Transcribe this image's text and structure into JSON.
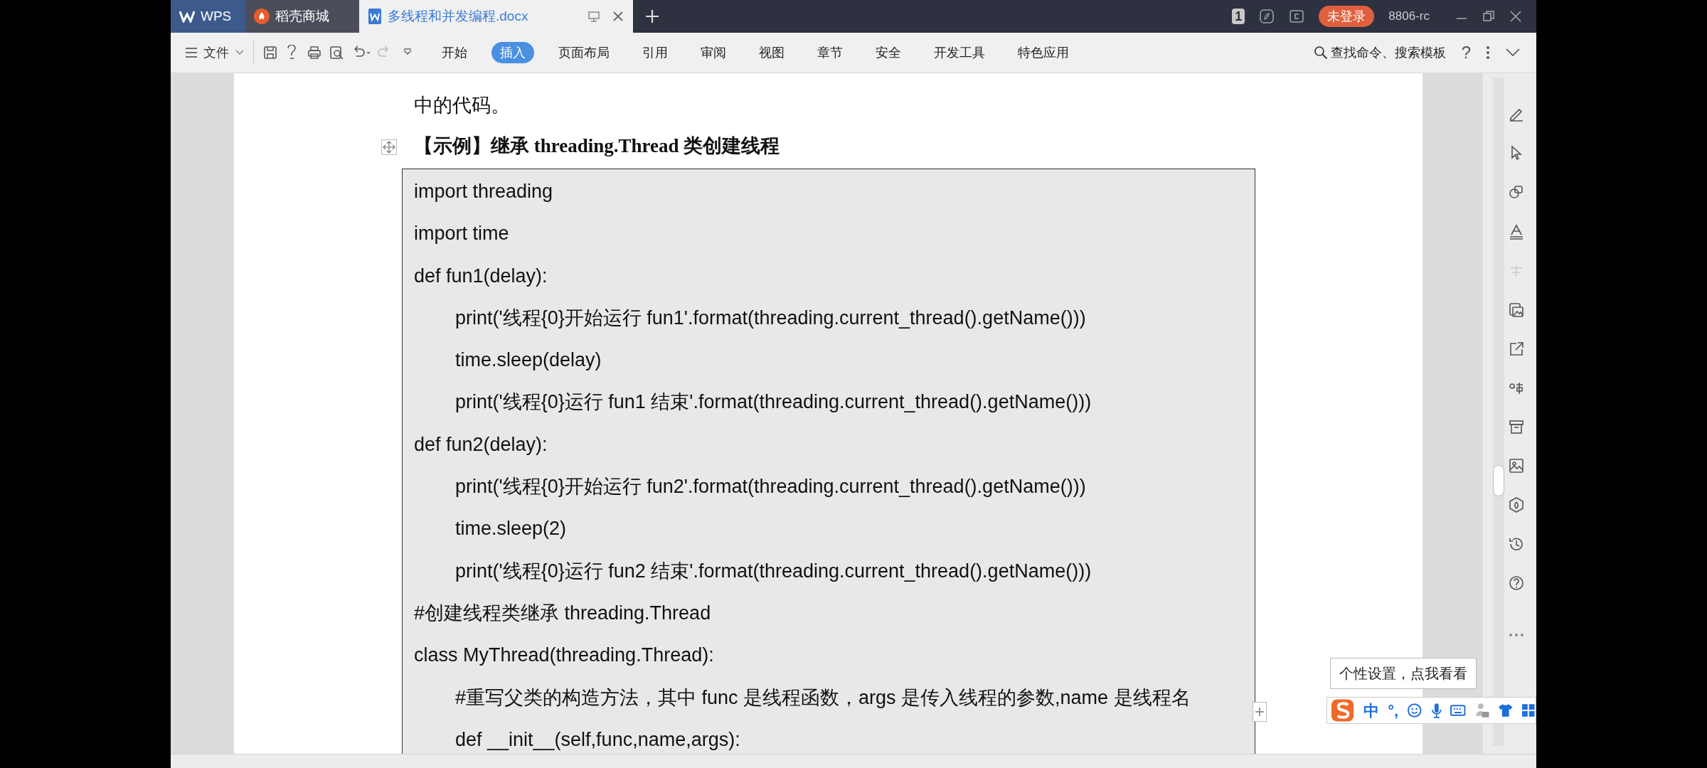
{
  "tabs": [
    {
      "kind": "home",
      "label": "WPS",
      "selected": false
    },
    {
      "kind": "store",
      "label": "稻壳商城",
      "selected": false
    },
    {
      "kind": "doc",
      "label": "多线程和并发编程.docx",
      "selected": true
    }
  ],
  "title_bar": {
    "page_badge": "1",
    "login": "未登录",
    "user": "8806-rc"
  },
  "toolbar": {
    "file_menu": "文件",
    "ribbon_tabs": [
      {
        "label": "开始",
        "selected": false
      },
      {
        "label": "插入",
        "selected": true
      },
      {
        "label": "页面布局",
        "selected": false
      },
      {
        "label": "引用",
        "selected": false
      },
      {
        "label": "审阅",
        "selected": false
      },
      {
        "label": "视图",
        "selected": false
      },
      {
        "label": "章节",
        "selected": false
      },
      {
        "label": "安全",
        "selected": false
      },
      {
        "label": "开发工具",
        "selected": false
      },
      {
        "label": "特色应用",
        "selected": false
      }
    ],
    "search": "查找命令、搜索模板",
    "help": "?"
  },
  "document": {
    "paragraph": "中的代码。",
    "heading": "【示例】继承 threading.Thread 类创建线程",
    "code": [
      {
        "text": "import threading"
      },
      {
        "text": "import time"
      },
      {
        "text": "def fun1(delay):",
        "children": [
          {
            "text": "print('线程{0}开始运行 fun1'.format(threading.current_thread().getName()))"
          },
          {
            "text": "time.sleep(delay)"
          },
          {
            "text": "print('线程{0}运行 fun1 结束'.format(threading.current_thread().getName()))"
          }
        ]
      },
      {
        "text": "def fun2(delay):",
        "children": [
          {
            "text": "print('线程{0}开始运行 fun2'.format(threading.current_thread().getName()))"
          },
          {
            "text": "time.sleep(2)"
          },
          {
            "text": "print('线程{0}运行 fun2 结束'.format(threading.current_thread().getName()))"
          }
        ]
      },
      {
        "text": "#创建线程类继承 threading.Thread"
      },
      {
        "text": "class MyThread(threading.Thread):",
        "children": [
          {
            "text": "#重写父类的构造方法，其中 func 是线程函数，args 是传入线程的参数,name 是线程名"
          },
          {
            "text": "def __init__(self,func,name,args):"
          }
        ]
      }
    ]
  },
  "ime": {
    "tooltip": "个性设置，点我看看",
    "mode": "中",
    "punctuation": "°,"
  }
}
